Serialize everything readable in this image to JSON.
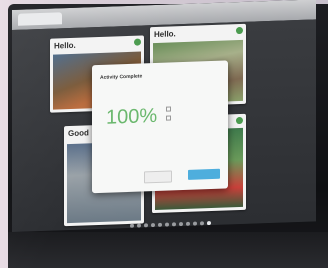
{
  "tiles": [
    {
      "title": "Hello."
    },
    {
      "title": "Hello."
    },
    {
      "title": "Good"
    }
  ],
  "modal": {
    "title": "Activity Complete",
    "percent": "100%"
  },
  "colors": {
    "accent_green": "#6bb86e",
    "button_blue": "#4eaedd",
    "add_green": "#4b9b4f"
  },
  "pager": {
    "count": 12,
    "active": 11
  }
}
